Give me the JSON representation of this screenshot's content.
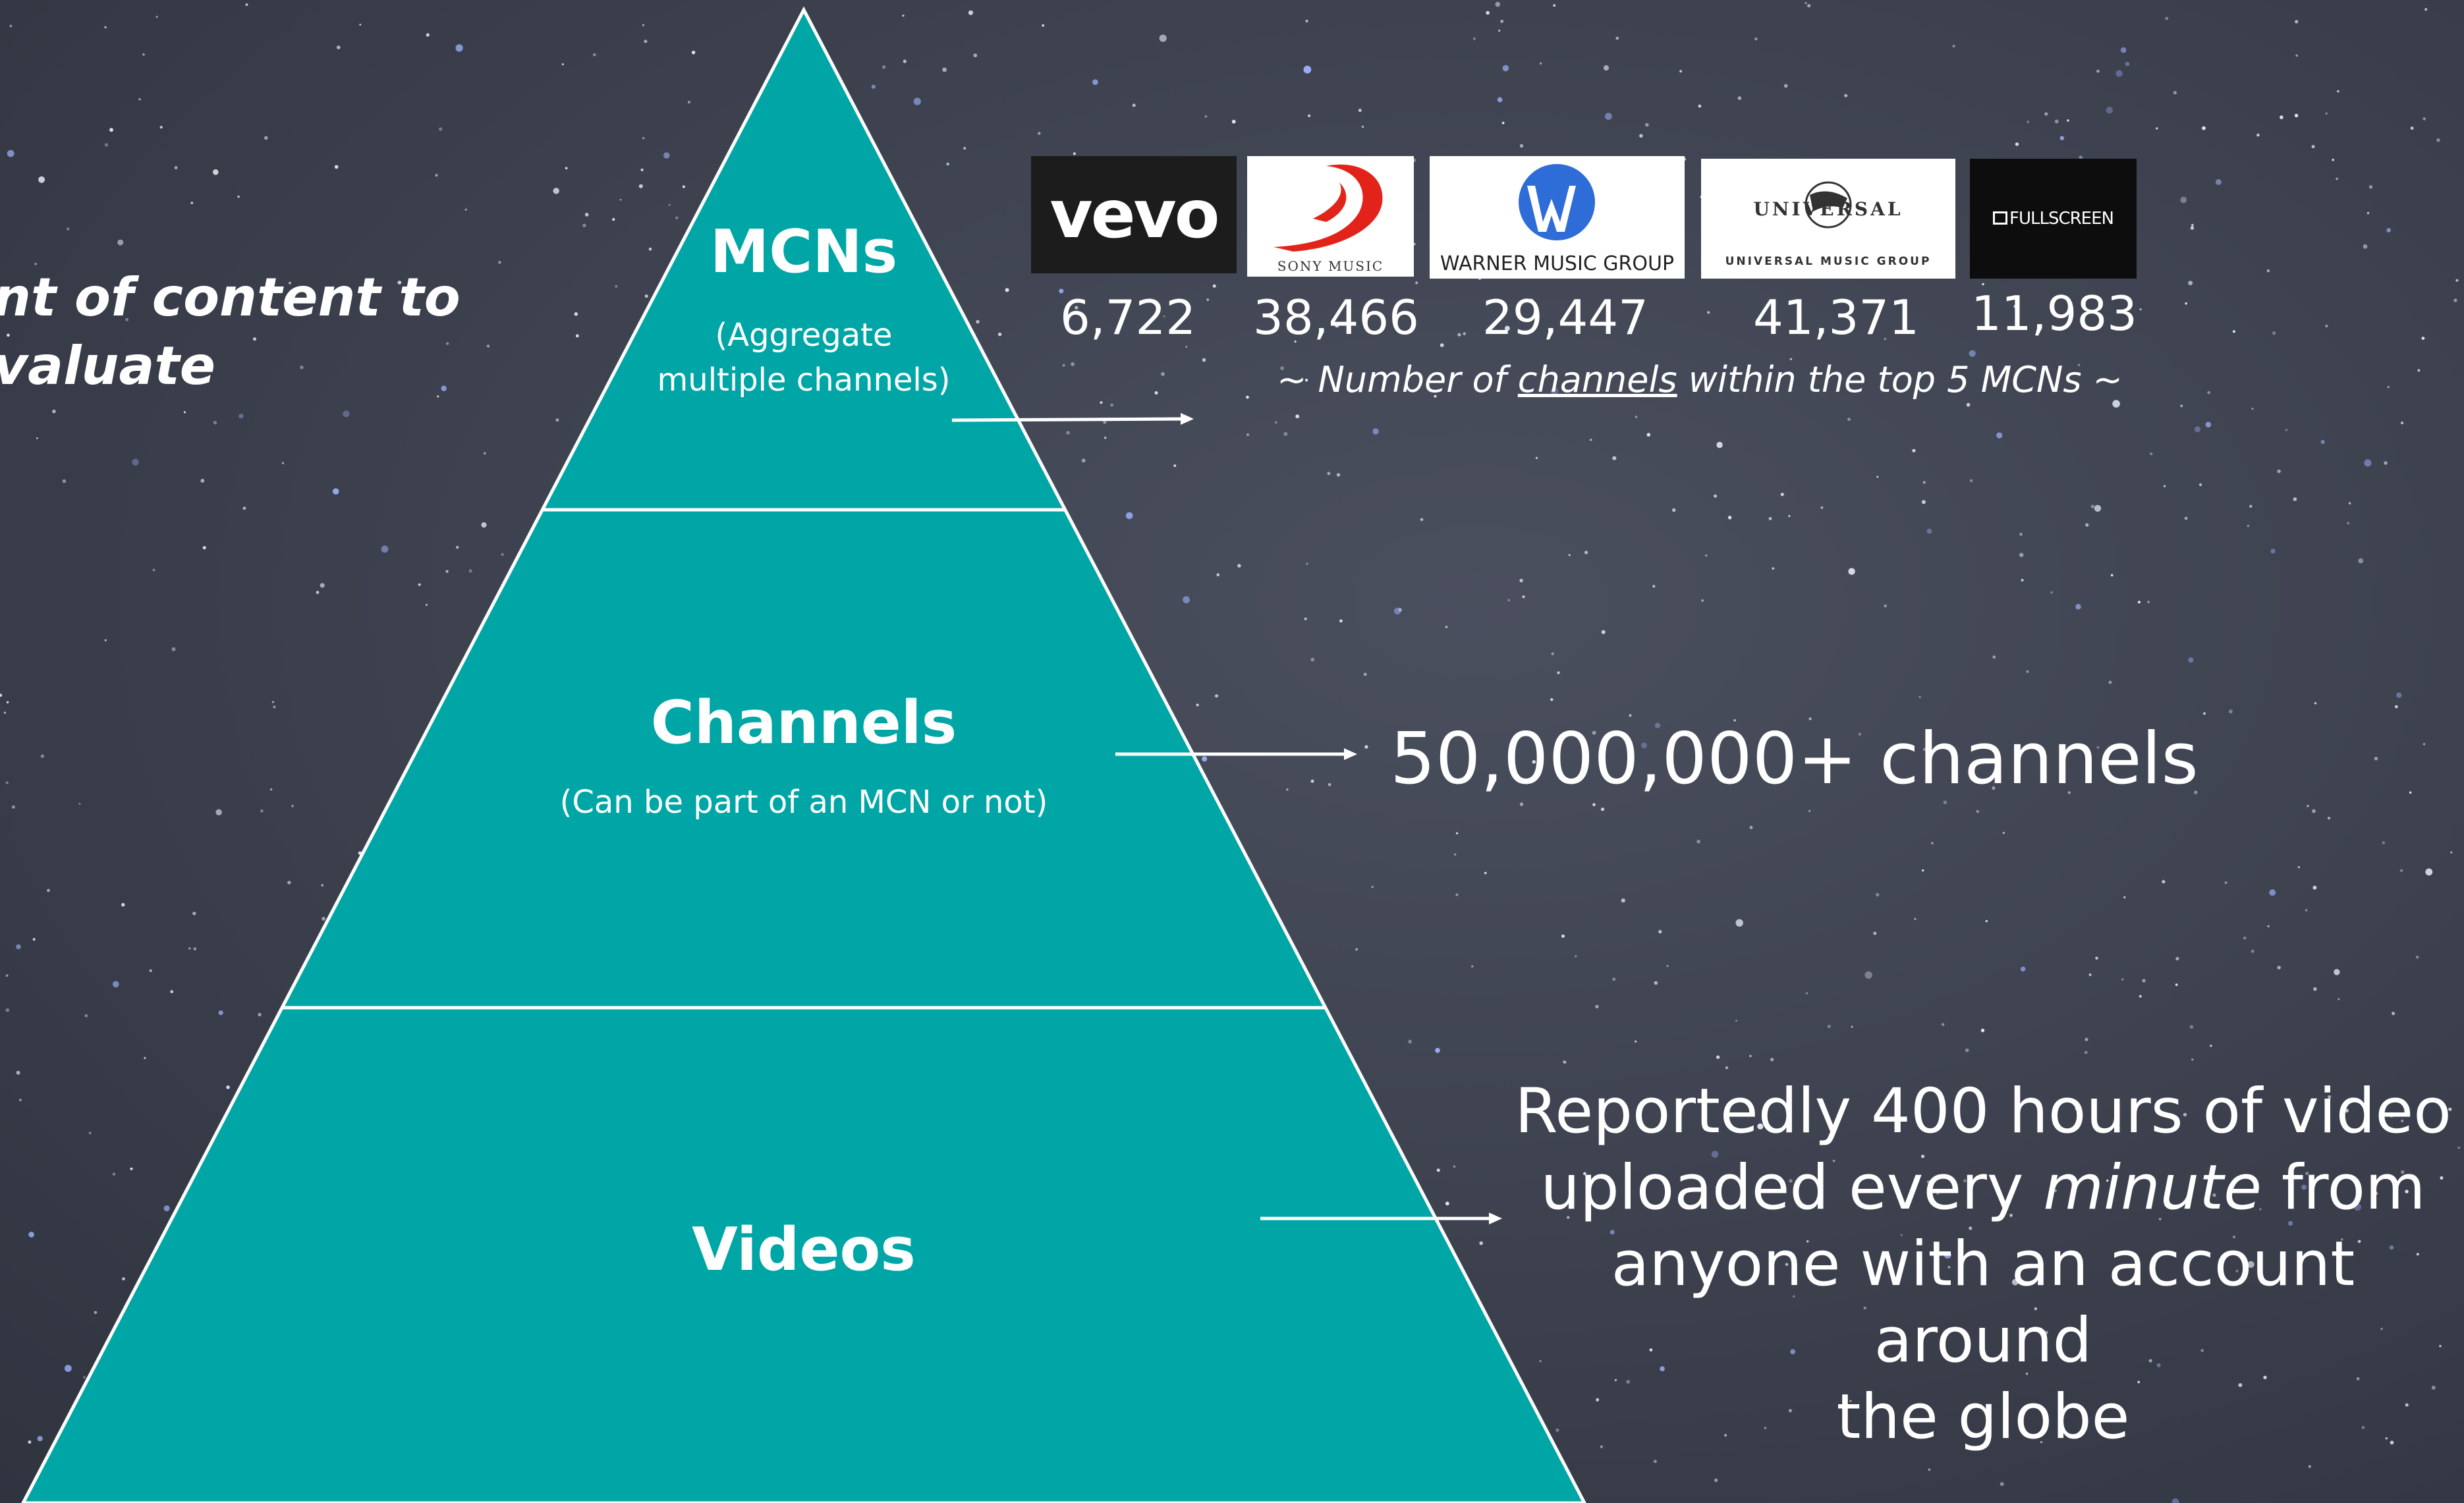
{
  "left_text": {
    "line1": "nt of content to",
    "line2": "valuate"
  },
  "pyramid": {
    "fill_color": "#00a6a6",
    "tiers": [
      {
        "title": "MCNs",
        "subtitle_line1": "(Aggregate",
        "subtitle_line2": "multiple channels)"
      },
      {
        "title": "Channels",
        "subtitle_line1": "(Can be part of an MCN or not)"
      },
      {
        "title": "Videos"
      }
    ]
  },
  "mcn_logos": [
    {
      "label": "vevo",
      "count": "6,722"
    },
    {
      "label": "SONY MUSIC",
      "count": "38,466"
    },
    {
      "label": "WARNER MUSIC GROUP",
      "count": "29,447"
    },
    {
      "label_top": "UNIVERSAL",
      "label_bottom": "UNIVERSAL MUSIC GROUP",
      "count": "41,371"
    },
    {
      "label": "FULLSCREEN",
      "count": "11,983"
    }
  ],
  "mcn_caption": {
    "before": "~ Number of ",
    "underlined": "channels",
    "after": " within the top 5 MCNs ~"
  },
  "channels_count": "50,000,000+ channels",
  "videos_note": {
    "line1": "Reportedly 400 hours of video",
    "line2_before": "uploaded every ",
    "line2_italic": "minute",
    "line2_after": " from",
    "line3": "anyone with an account around",
    "line4": "the globe"
  }
}
